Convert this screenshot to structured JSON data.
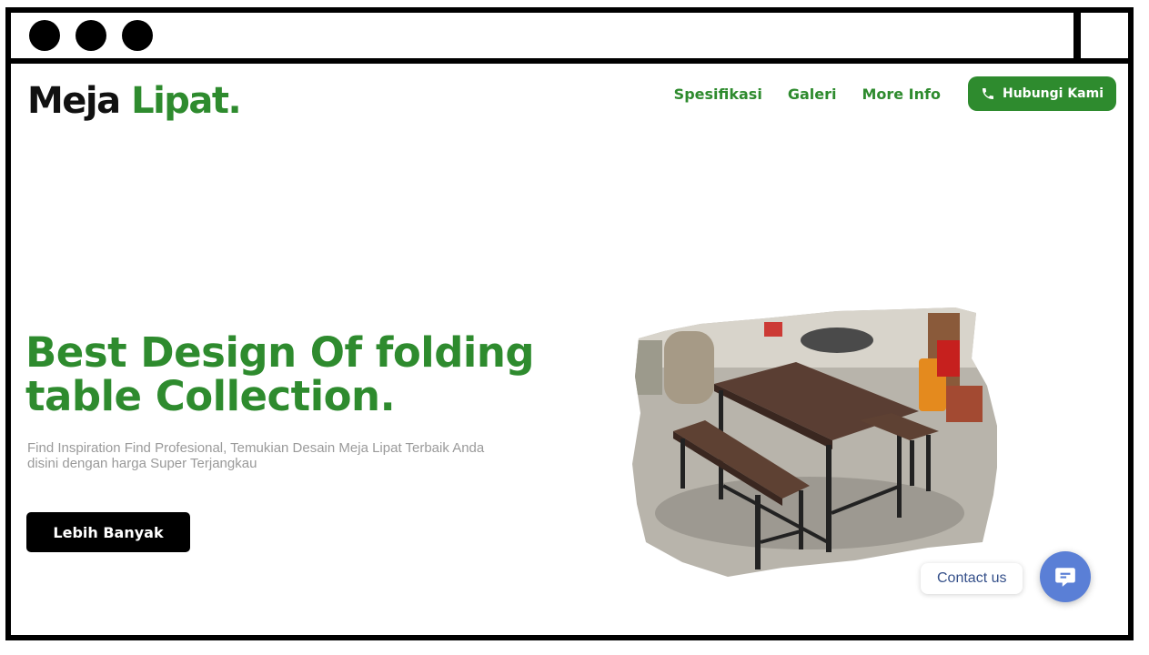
{
  "brand": {
    "logo_main": "Meja",
    "logo_accent": "Lipat."
  },
  "nav": {
    "links": [
      "Spesifikasi",
      "Galeri",
      "More Info"
    ],
    "cta_label": "Hubungi Kami"
  },
  "hero": {
    "title_line1": "Best Design Of folding",
    "title_line2": "table Collection.",
    "subtitle": "Find Inspiration Find Profesional, Temukian Desain Meja Lipat Terbaik Anda disini dengan harga Super Terjangkau",
    "button_label": "Lebih Banyak"
  },
  "chat_widget": {
    "label": "Contact us"
  },
  "colors": {
    "brand_green": "#2e8b2e",
    "chat_blue": "#5a7fd6",
    "frame": "#000000"
  },
  "icons": {
    "cta": "phone-icon",
    "chat": "chat-bubble-icon"
  }
}
